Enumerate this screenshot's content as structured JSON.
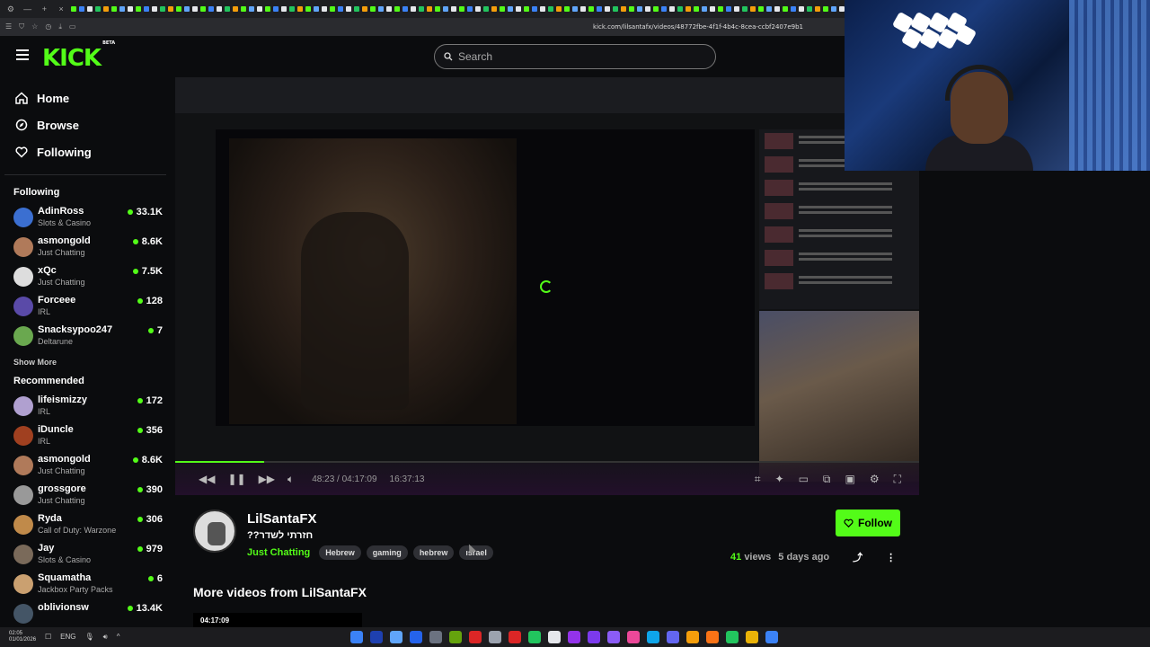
{
  "browser": {
    "url": "kick.com/lilsantafx/videos/48772fbe-4f1f-4b4c-8cea-ccbf2407e9b1"
  },
  "header": {
    "logo_text": "KICK",
    "logo_badge": "BETA",
    "search_placeholder": "Search"
  },
  "nav": [
    {
      "label": "Home",
      "icon": "home-icon"
    },
    {
      "label": "Browse",
      "icon": "compass-icon"
    },
    {
      "label": "Following",
      "icon": "heart-icon"
    }
  ],
  "following": {
    "title": "Following",
    "channels": [
      {
        "name": "AdinRoss",
        "category": "Slots & Casino",
        "viewers": "33.1K",
        "color": "#3b6fd1"
      },
      {
        "name": "asmongold",
        "category": "Just Chatting",
        "viewers": "8.6K",
        "color": "#b07a5a"
      },
      {
        "name": "xQc",
        "category": "Just Chatting",
        "viewers": "7.5K",
        "color": "#dddddd"
      },
      {
        "name": "Forceee",
        "category": "IRL",
        "viewers": "128",
        "color": "#5a4aa8"
      },
      {
        "name": "Snacksypoo247",
        "category": "Deltarune",
        "viewers": "7",
        "color": "#6aa84f"
      }
    ],
    "show_more": "Show More"
  },
  "recommended": {
    "title": "Recommended",
    "channels": [
      {
        "name": "lifeismizzy",
        "category": "IRL",
        "viewers": "172",
        "color": "#b0a0d0"
      },
      {
        "name": "iDuncle",
        "category": "IRL",
        "viewers": "356",
        "color": "#a04020"
      },
      {
        "name": "asmongold",
        "category": "Just Chatting",
        "viewers": "8.6K",
        "color": "#b07a5a"
      },
      {
        "name": "grossgore",
        "category": "Just Chatting",
        "viewers": "390",
        "color": "#999999"
      },
      {
        "name": "Ryda",
        "category": "Call of Duty: Warzone",
        "viewers": "306",
        "color": "#c08a4a"
      },
      {
        "name": "Jay",
        "category": "Slots & Casino",
        "viewers": "979",
        "color": "#7a6a5a"
      },
      {
        "name": "Squamatha",
        "category": "Jackbox Party Packs",
        "viewers": "6",
        "color": "#caa070"
      },
      {
        "name": "oblivionsw",
        "category": "",
        "viewers": "13.4K",
        "color": "#445566"
      }
    ]
  },
  "player": {
    "current_time": "48:23 / 04:17:09",
    "extra_time": "16:37:13",
    "progress": 0.12
  },
  "video": {
    "streamer": "LilSantaFX",
    "title": "חזרתי לשדר??",
    "category": "Just Chatting",
    "tags": [
      "Hebrew",
      "gaming",
      "hebrew",
      "ısrael"
    ],
    "follow_label": "Follow",
    "views_count": "41",
    "views_label": "views",
    "posted": "5 days ago"
  },
  "more_videos": {
    "title": "More videos from LilSantaFX",
    "first_duration": "04:17:09"
  },
  "taskbar": {
    "time": "02:05",
    "date": "01/01/2026",
    "lang": "ENG"
  }
}
